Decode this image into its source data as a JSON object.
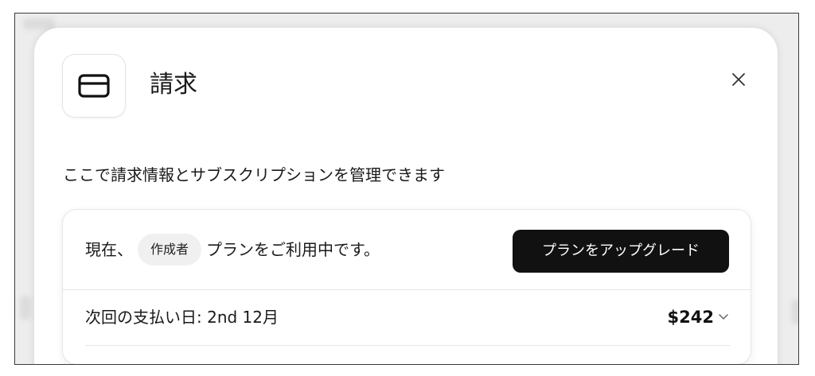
{
  "modal": {
    "title": "請求",
    "description": "ここで請求情報とサブスクリプションを管理できます"
  },
  "plan": {
    "prefix": "現在、",
    "badge": "作成者",
    "suffix": "プランをご利用中です。",
    "upgrade_label": "プランをアップグレード"
  },
  "billing": {
    "next_payment": "次回の支払い日: 2nd 12月",
    "amount": "$242"
  },
  "icons": {
    "card": "credit-card-icon",
    "close": "close-icon",
    "expand": "chevron-down-icon"
  }
}
